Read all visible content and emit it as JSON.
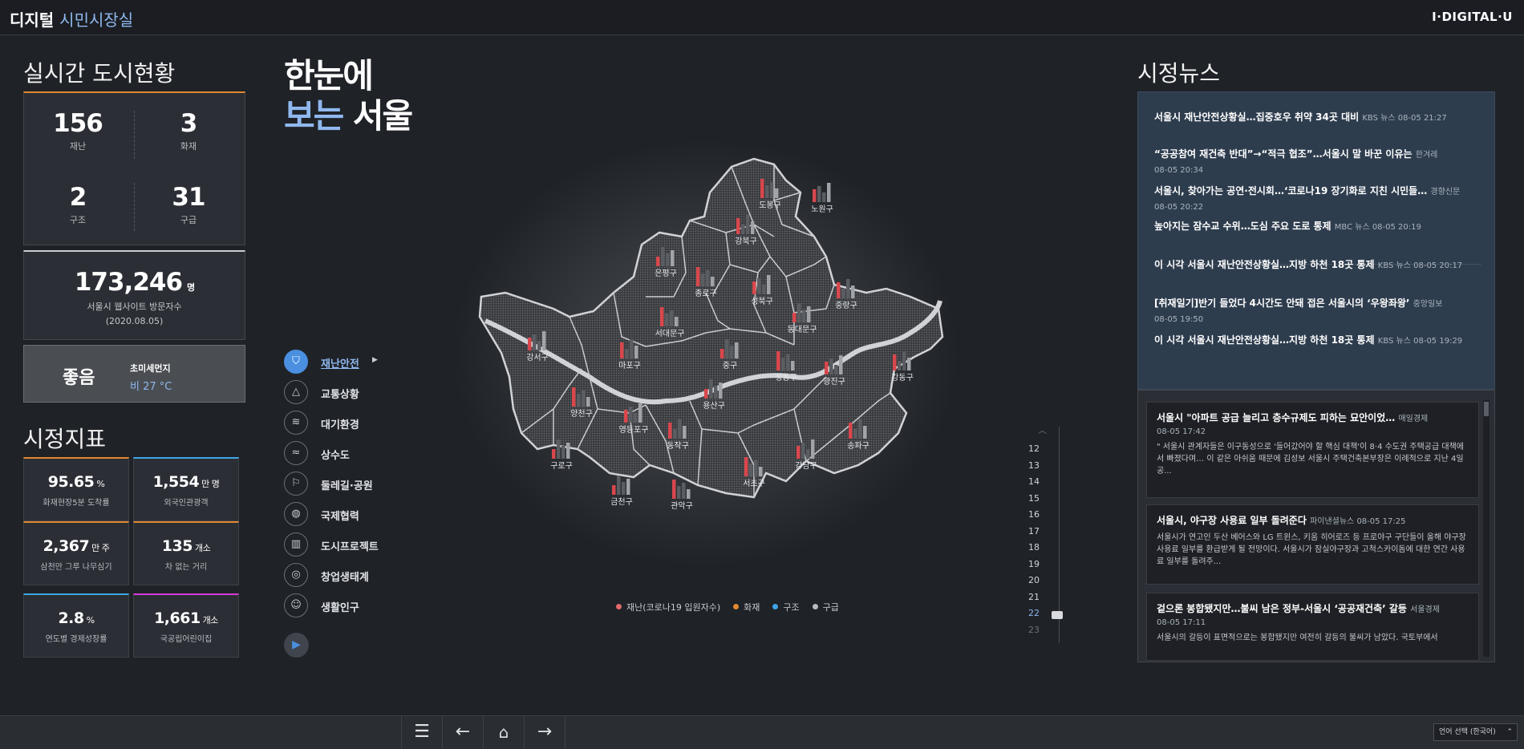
{
  "header": {
    "brand_main": "디지털 ",
    "brand_hl": "시민시장실",
    "logo_right": "I·DIGITAL·U"
  },
  "city_status": {
    "title": "실시간 도시현황",
    "stats": [
      {
        "value": "156",
        "label": "재난"
      },
      {
        "value": "3",
        "label": "화재"
      },
      {
        "value": "2",
        "label": "구조"
      },
      {
        "value": "31",
        "label": "구급"
      }
    ],
    "visitors": {
      "value": "173,246",
      "unit": "명",
      "label": "서울시 웹사이트 방문자수",
      "date": "(2020.08.05)"
    },
    "air": {
      "grade": "좋음",
      "label": "초미세먼지",
      "weather": "비 27 °C"
    }
  },
  "indicators": {
    "title": "시정지표",
    "items": [
      {
        "value": "95.65",
        "unit": "%",
        "label": "화재현장5분 도착률",
        "accent": "#e0892f"
      },
      {
        "value": "1,554",
        "unit": "만 명",
        "label": "외국인관광객",
        "accent": "#3ea6e6"
      },
      {
        "value": "2,367",
        "unit": "만 주",
        "label": "삼천만 그루 나무심기",
        "accent": "#e0892f"
      },
      {
        "value": "135",
        "unit": "개소",
        "label": "차 없는 거리",
        "accent": "#e0892f"
      },
      {
        "value": "2.8",
        "unit": "%",
        "label": "연도별 경제성장률",
        "accent": "#3ea6e6"
      },
      {
        "value": "1,661",
        "unit": "개소",
        "label": "국공립어린이집",
        "accent": "#d83ad8"
      }
    ]
  },
  "hero": {
    "line1": "한눈에",
    "line2_blue": "보는",
    "line2_white": " 서울"
  },
  "menu": [
    {
      "label": "재난안전",
      "icon": "shield-icon",
      "glyph": "⛉",
      "active": true
    },
    {
      "label": "교통상황",
      "icon": "road-icon",
      "glyph": "△"
    },
    {
      "label": "대기환경",
      "icon": "wind-icon",
      "glyph": "≋"
    },
    {
      "label": "상수도",
      "icon": "water-icon",
      "glyph": "≈"
    },
    {
      "label": "둘레길·공원",
      "icon": "signpost-icon",
      "glyph": "⚐"
    },
    {
      "label": "국제협력",
      "icon": "globe-icon",
      "glyph": "◍"
    },
    {
      "label": "도시프로젝트",
      "icon": "building-icon",
      "glyph": "▥"
    },
    {
      "label": "창업생태계",
      "icon": "bulb-icon",
      "glyph": "◎"
    },
    {
      "label": "생활인구",
      "icon": "people-icon",
      "glyph": "☺"
    }
  ],
  "map": {
    "districts": [
      "도봉구",
      "노원구",
      "강북구",
      "은평구",
      "종로구",
      "성북구",
      "중랑구",
      "동대문구",
      "서대문구",
      "강서구",
      "마포구",
      "중구",
      "성동구",
      "광진구",
      "강동구",
      "용산구",
      "양천구",
      "영등포구",
      "동작구",
      "구로구",
      "서초구",
      "강남구",
      "송파구",
      "금천구",
      "관악구"
    ],
    "legend": [
      {
        "label": "재난(코로나19 입원자수)",
        "color": "#e06a6a"
      },
      {
        "label": "화재",
        "color": "#e0892f"
      },
      {
        "label": "구조",
        "color": "#3ea6e6"
      },
      {
        "label": "구급",
        "color": "#b8bbc0"
      }
    ]
  },
  "timeline": {
    "hours": [
      "12",
      "13",
      "14",
      "15",
      "16",
      "17",
      "18",
      "19",
      "20",
      "21",
      "22",
      "23"
    ],
    "current": "22"
  },
  "news": {
    "title": "시정뉴스",
    "top": [
      {
        "title": "서울시 재난안전상황실…집중호우 취약 34곳 대비",
        "src": "KBS 뉴스  08-05  21:27"
      },
      {
        "title": "“공공참여 재건축 반대”→“적극 협조”…서울시 말 바꾼 이유는",
        "src": "한겨레",
        "date": "08-05  20:34"
      },
      {
        "title": "서울시, 찾아가는 공연·전시회…‘코로나19 장기화로 지친 시민들…",
        "src": "경향신문",
        "date": "08-05  20:22"
      },
      {
        "title": "높아지는 잠수교 수위…도심 주요 도로 통제",
        "src": "MBC 뉴스  08-05  20:19"
      },
      {
        "title": "이 시각 서울시 재난안전상황실…지방 하천 18곳 통제",
        "src": "KBS 뉴스  08-05  20:17"
      },
      {
        "title": "[취재일기]반기 들었다 4시간도 안돼 접은 서울시의 ‘우왕좌왕’",
        "src": "중앙일보",
        "date": "08-05  19:50"
      },
      {
        "title": "이 시각 서울시 재난안전상황실…지방 하천 18곳 통제",
        "src": "KBS 뉴스  08-05  19:29"
      }
    ],
    "cards": [
      {
        "title": "서울시 \"아파트 공급 늘리고 층수규제도 피하는 묘안이었…",
        "src": "매일경제",
        "date": "08-05  17:42",
        "body": "\" 서울시 관계자들은 이구동성으로 '들어갔어야 할 핵심 대책'이 8·4 수도권 주택공급 대책에서 빠졌다며… 이 같은 아쉬움 때문에 김성보 서울시 주택건축본부장은 이례적으로 지난 4일 공..."
      },
      {
        "title": "서울시, 야구장 사용료 일부 돌려준다",
        "src": "파이낸셜뉴스  08-05  17:25",
        "date": "",
        "body": "서울시가 연고인 두산 베어스와 LG 트윈스, 키움 히어로즈 등 프로야구 구단들이 올해 야구장 사용료 일부를 환급받게 될 전망이다. 서울시가 잠실야구장과 고척스카이돔에 대한 연간 사용료 일부를 돌려주..."
      },
      {
        "title": "겉으론 봉합됐지만…불씨 남은 정부-서울시 ‘공공재건축’ 갈등",
        "src": "서울경제",
        "date": "08-05  17:11",
        "body": "서울시의 갈등이 표면적으로는 봉합됐지만 여전히 갈등의 불씨가 남았다. 국토부에서"
      }
    ]
  },
  "bottom": {
    "lang": "언어 선택 (한국어)"
  }
}
